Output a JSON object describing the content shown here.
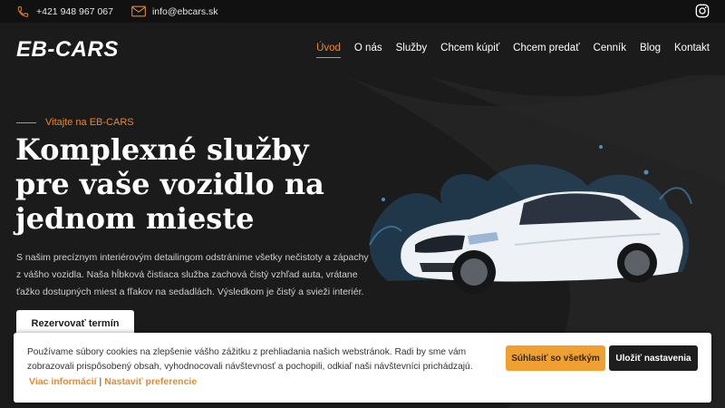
{
  "topbar": {
    "phone": "+421 948 967 067",
    "email": "info@ebcars.sk",
    "phone_icon": "phone-icon",
    "email_icon": "envelope-icon",
    "social_icon": "instagram-icon"
  },
  "header": {
    "logo": "EB-CARS",
    "nav": [
      {
        "label": "Úvod",
        "active": true
      },
      {
        "label": "O nás"
      },
      {
        "label": "Služby"
      },
      {
        "label": "Chcem kúpiť"
      },
      {
        "label": "Chcem predať"
      },
      {
        "label": "Cenník"
      },
      {
        "label": "Blog"
      },
      {
        "label": "Kontakt"
      }
    ]
  },
  "hero": {
    "kicker": "Vitajte na EB-CARS",
    "headline": "Komplexné služby pre vaše vozidlo na jednom mieste",
    "description": "S našim precíznym interiérovým detailingom odstránime všetky nečistoty a zápachy z vášho vozidla. Naša hĺbková čistiaca služba zachová čistý vzhľad auta, vrátane ťažko dostupných miest a fľakov na sedadlách. Výsledkom je čistý a svieži interiér.",
    "cta": "Rezervovať termín"
  },
  "cookie": {
    "text": "Používame súbory cookies na zlepšenie vášho zážitku z prehliadania našich webstránok. Radi by sme vám zobrazovali prispôsobený obsah, vyhodnocovali návštevnosť a pochopili, odkiaľ naši návštevníci prichádzajú.",
    "link_more": "Viac informácií",
    "separator": "|",
    "link_prefs": "Nastaviť preferencie",
    "accept": "Súhlasiť so všetkým",
    "save": "Uložiť nastavenia"
  },
  "colors": {
    "accent": "#e8892a",
    "background": "#1b1b1c",
    "accept_button": "#f0a030"
  }
}
